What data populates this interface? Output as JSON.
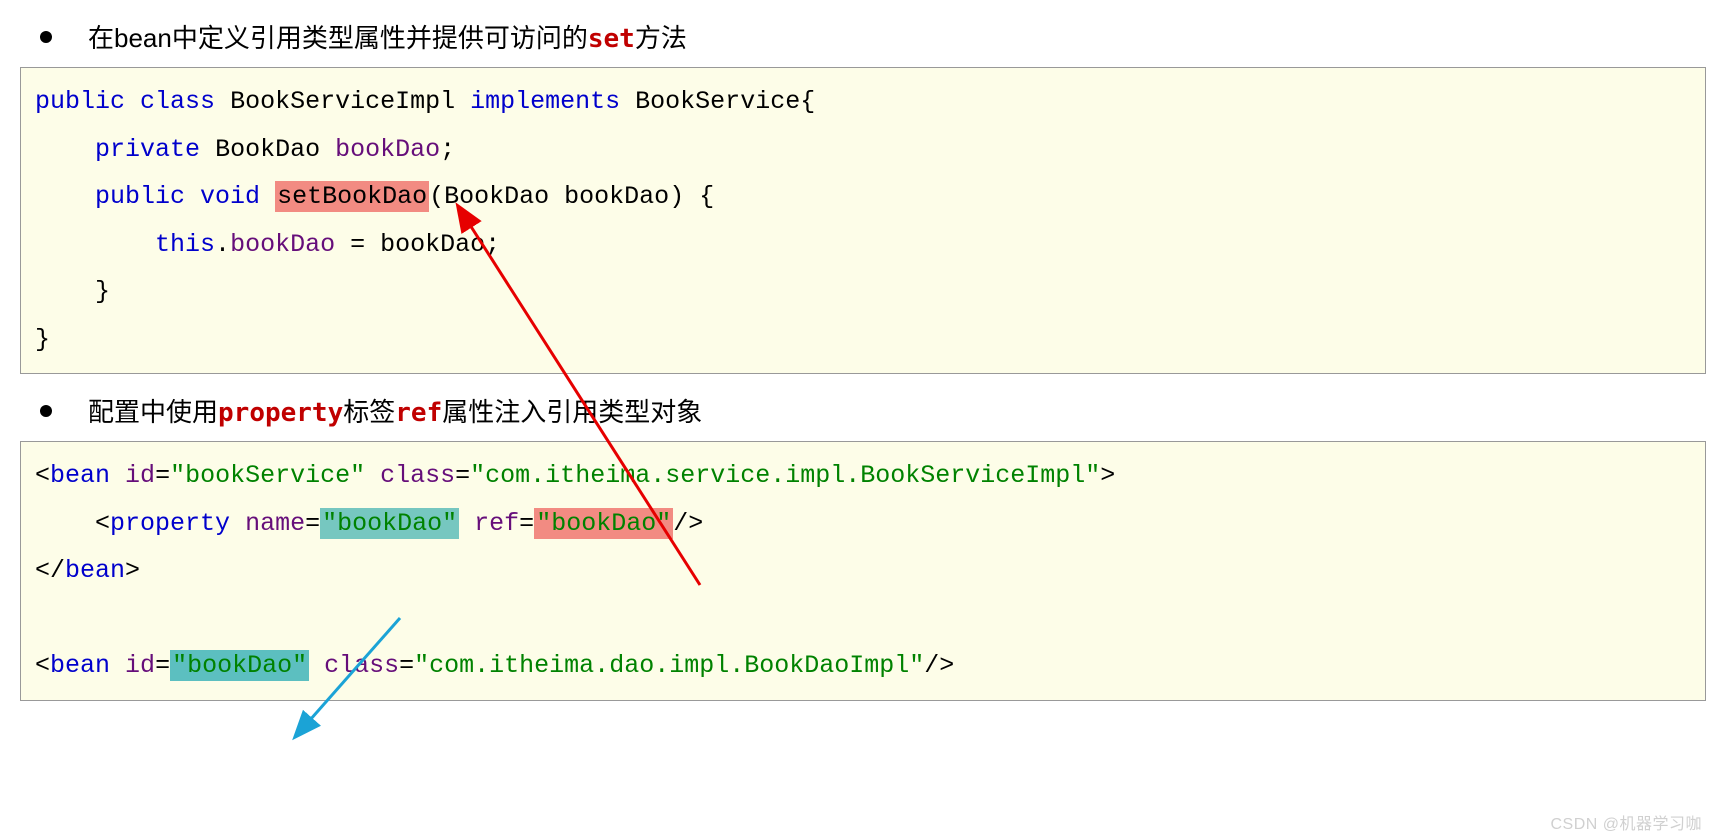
{
  "bullet1": {
    "pre": "在bean中定义引用类型属性并提供可访问的",
    "kw": "set",
    "post": "方法"
  },
  "code1": {
    "line1": {
      "public": "public",
      "class": "class",
      "name": "BookServiceImpl",
      "implements": "implements",
      "iface": "BookService",
      "brace": "{"
    },
    "line2": {
      "private": "private",
      "type": "BookDao",
      "field": "bookDao",
      "semi": ";"
    },
    "line3": {
      "public": "public",
      "void": "void",
      "method": "setBookDao",
      "lp": "(",
      "ptype": "BookDao",
      "pname": "bookDao",
      "rp": ")",
      "brace": " {"
    },
    "line4": {
      "this": "this",
      "dot": ".",
      "field": "bookDao",
      "eq": " = ",
      "rhs": "bookDao",
      "semi": ";"
    },
    "line5": {
      "brace": "}"
    },
    "line6": {
      "brace": "}"
    }
  },
  "bullet2": {
    "pre": "配置中使用",
    "kw1": "property",
    "mid": "标签",
    "kw2": "ref",
    "post": "属性注入引用类型对象"
  },
  "code2": {
    "line1": {
      "lt": "<",
      "tag": "bean",
      "sp1": " ",
      "a1": "id",
      "eq1": "=",
      "v1": "\"bookService\"",
      "sp2": " ",
      "a2": "class",
      "eq2": "=",
      "v2": "\"com.itheima.service.impl.BookServiceImpl\"",
      "gt": ">"
    },
    "line2": {
      "lt": "<",
      "tag": "property",
      "sp1": " ",
      "a1": "name",
      "eq1": "=",
      "v1": "\"bookDao\"",
      "sp2": " ",
      "a2": "ref",
      "eq2": "=",
      "v2": "\"bookDao\"",
      "end": "/>"
    },
    "line3": {
      "lt": "</",
      "tag": "bean",
      "gt": ">"
    },
    "line4": {
      "lt": "<",
      "tag": "bean",
      "sp1": " ",
      "a1": "id",
      "eq1": "=",
      "v1": "\"bookDao\"",
      "sp2": " ",
      "a2": "class",
      "eq2": "=",
      "v2": "\"com.itheima.dao.impl.BookDaoImpl\"",
      "end": "/>"
    }
  },
  "watermark": "CSDN @机器学习咖"
}
